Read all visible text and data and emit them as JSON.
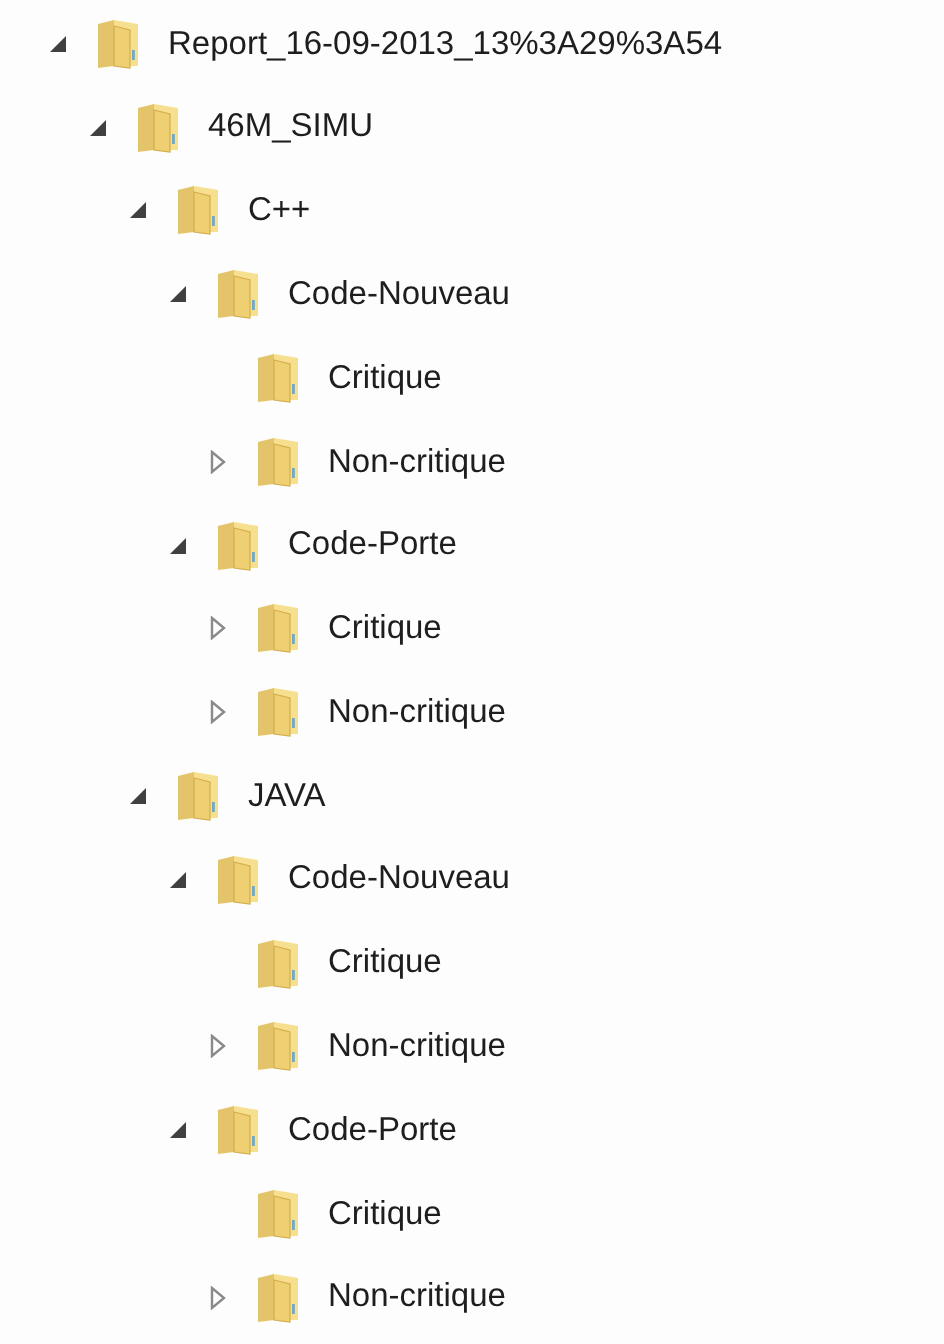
{
  "tree": [
    {
      "label": "Report_16-09-2013_13%3A29%3A54",
      "expanded": true,
      "children": [
        {
          "label": "46M_SIMU",
          "expanded": true,
          "children": [
            {
              "label": "C++",
              "expanded": true,
              "children": [
                {
                  "label": "Code-Nouveau",
                  "expanded": true,
                  "children": [
                    {
                      "label": "Critique"
                    },
                    {
                      "label": "Non-critique",
                      "expanded": false
                    }
                  ]
                },
                {
                  "label": "Code-Porte",
                  "expanded": true,
                  "children": [
                    {
                      "label": "Critique",
                      "expanded": false
                    },
                    {
                      "label": "Non-critique",
                      "expanded": false
                    }
                  ]
                }
              ]
            },
            {
              "label": "JAVA",
              "expanded": true,
              "children": [
                {
                  "label": "Code-Nouveau",
                  "expanded": true,
                  "children": [
                    {
                      "label": "Critique"
                    },
                    {
                      "label": "Non-critique",
                      "expanded": false
                    }
                  ]
                },
                {
                  "label": "Code-Porte",
                  "expanded": true,
                  "children": [
                    {
                      "label": "Critique"
                    },
                    {
                      "label": "Non-critique",
                      "expanded": false
                    }
                  ]
                }
              ]
            }
          ]
        }
      ]
    }
  ]
}
